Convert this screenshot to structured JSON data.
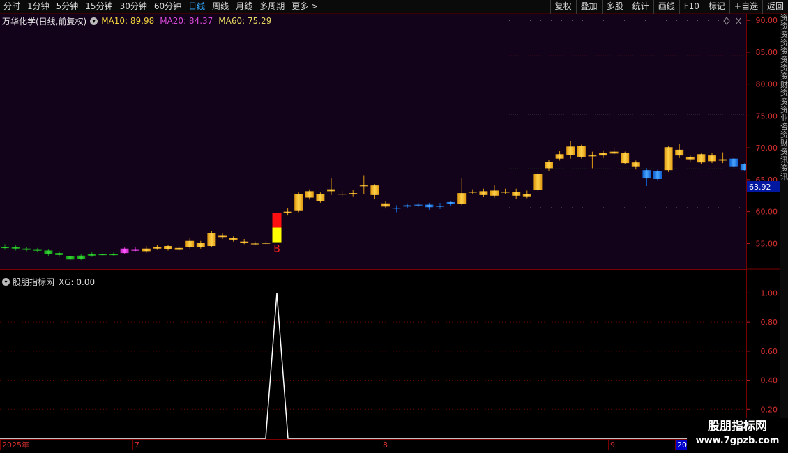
{
  "toolbar": {
    "periods": [
      "分时",
      "1分钟",
      "5分钟",
      "15分钟",
      "30分钟",
      "60分钟",
      "日线",
      "周线",
      "月线",
      "多周期",
      "更多"
    ],
    "active_index": 6,
    "right_items": [
      "复权",
      "叠加",
      "多股",
      "统计",
      "画线",
      "F10",
      "标记",
      "+自选",
      "返回"
    ]
  },
  "k_header": {
    "stock": "万华化学(日线,前复权)",
    "ma10": "MA10: 89.98",
    "ma20": "MA20: 84.37",
    "ma60": "MA60: 75.29"
  },
  "sub_header": {
    "title": "股朋指标网",
    "xg": "XG: 0.00"
  },
  "price_axis": [
    "90.00",
    "85.00",
    "80.00",
    "75.00",
    "70.00",
    "65.00",
    "60.00",
    "55.00"
  ],
  "current_price": "63.92",
  "sub_axis": [
    "1.00",
    "0.80",
    "0.60",
    "0.40",
    "0.20"
  ],
  "dates": [
    {
      "label": "2025年",
      "highlight": false
    },
    {
      "label": "7",
      "highlight": false
    },
    {
      "label": "8",
      "highlight": false
    },
    {
      "label": "9",
      "highlight": false
    },
    {
      "label": "20",
      "highlight": true
    }
  ],
  "signal_label": "B",
  "side_strip": "资资资资资资资资财资资资业咨资财资讯资讯",
  "watermark": {
    "line1": "股朋指标网",
    "line2": "www.7gpzb.com"
  },
  "chart_data": {
    "type": "candlestick",
    "y_range": [
      51,
      91
    ],
    "sub_y_range": [
      0,
      1.05
    ],
    "reference_lines": [
      {
        "value": 90.0,
        "color": "#888888"
      },
      {
        "value": 84.4,
        "color": "#d03030"
      },
      {
        "value": 75.3,
        "color": "#cccccc"
      },
      {
        "value": 66.7,
        "color": "#2e9e2e"
      },
      {
        "value": 60.6,
        "color": "#888888"
      }
    ],
    "candles": [
      [
        54.4,
        54.4,
        54.9,
        54.0,
        "green"
      ],
      [
        54.4,
        54.2,
        54.7,
        53.9,
        "green"
      ],
      [
        54.2,
        54.0,
        54.5,
        53.8,
        "green"
      ],
      [
        54.0,
        53.9,
        54.3,
        53.6,
        "green"
      ],
      [
        53.9,
        53.4,
        54.1,
        53.0,
        "green"
      ],
      [
        53.5,
        53.2,
        53.8,
        52.9,
        "green"
      ],
      [
        53.0,
        52.5,
        53.2,
        52.2,
        "green"
      ],
      [
        52.6,
        53.1,
        53.4,
        52.4,
        "green"
      ],
      [
        53.1,
        53.4,
        53.7,
        52.9,
        "green"
      ],
      [
        53.3,
        53.3,
        53.6,
        53.0,
        "green"
      ],
      [
        53.3,
        53.2,
        53.6,
        53.0,
        "green"
      ],
      [
        53.5,
        54.2,
        54.4,
        53.3,
        "magenta"
      ],
      [
        54.0,
        54.0,
        54.5,
        53.8,
        "magenta"
      ],
      [
        53.8,
        54.2,
        54.6,
        53.5,
        "gold"
      ],
      [
        54.2,
        54.5,
        54.8,
        54.0,
        "gold"
      ],
      [
        54.1,
        54.6,
        54.8,
        53.9,
        "gold"
      ],
      [
        54.0,
        54.3,
        54.6,
        53.8,
        "gold"
      ],
      [
        54.4,
        55.4,
        55.8,
        54.2,
        "gold"
      ],
      [
        54.4,
        55.1,
        55.4,
        54.2,
        "gold"
      ],
      [
        54.6,
        56.6,
        57.0,
        54.4,
        "gold"
      ],
      [
        56.0,
        56.3,
        56.6,
        55.7,
        "gold"
      ],
      [
        55.6,
        55.9,
        56.1,
        55.3,
        "gold"
      ],
      [
        55.1,
        55.3,
        55.7,
        54.9,
        "gold"
      ],
      [
        54.9,
        55.0,
        55.3,
        54.7,
        "gold"
      ],
      [
        55.0,
        55.1,
        55.4,
        54.8,
        "gold"
      ],
      [
        55.2,
        59.8,
        59.8,
        55.2,
        "redyellow"
      ],
      [
        59.8,
        60.0,
        60.5,
        59.4,
        "gold"
      ],
      [
        60.1,
        62.8,
        63.0,
        59.9,
        "gold"
      ],
      [
        62.2,
        63.2,
        63.5,
        61.9,
        "gold"
      ],
      [
        61.6,
        62.7,
        63.0,
        61.4,
        "gold"
      ],
      [
        63.2,
        63.5,
        65.2,
        62.6,
        "gold"
      ],
      [
        62.7,
        62.8,
        63.3,
        62.3,
        "gold"
      ],
      [
        62.8,
        62.9,
        63.4,
        62.4,
        "gold"
      ],
      [
        64.0,
        64.1,
        65.7,
        62.7,
        "gold"
      ],
      [
        62.6,
        64.1,
        64.3,
        62.0,
        "gold"
      ],
      [
        61.3,
        60.8,
        61.7,
        60.5,
        "gold"
      ],
      [
        60.6,
        60.6,
        61.0,
        59.9,
        "blue"
      ],
      [
        60.8,
        61.0,
        61.3,
        60.5,
        "blue"
      ],
      [
        61.0,
        61.1,
        61.4,
        60.7,
        "blue"
      ],
      [
        61.1,
        60.7,
        61.4,
        60.3,
        "blue"
      ],
      [
        60.9,
        60.9,
        61.4,
        60.4,
        "blue"
      ],
      [
        61.2,
        61.5,
        61.7,
        60.9,
        "blue"
      ],
      [
        61.2,
        62.9,
        65.3,
        61.0,
        "gold"
      ],
      [
        63.0,
        63.1,
        63.5,
        62.8,
        "gold"
      ],
      [
        62.6,
        63.2,
        63.6,
        62.3,
        "gold"
      ],
      [
        62.5,
        63.3,
        64.1,
        62.2,
        "gold"
      ],
      [
        63.0,
        63.1,
        63.6,
        62.7,
        "gold"
      ],
      [
        63.1,
        62.5,
        63.6,
        62.0,
        "gold"
      ],
      [
        62.4,
        62.8,
        63.3,
        62.1,
        "gold"
      ],
      [
        63.4,
        65.9,
        66.2,
        63.1,
        "gold"
      ],
      [
        66.8,
        67.8,
        68.1,
        66.3,
        "gold"
      ],
      [
        68.3,
        69.0,
        69.5,
        68.0,
        "gold"
      ],
      [
        70.2,
        68.9,
        71.0,
        68.3,
        "gold"
      ],
      [
        68.6,
        70.3,
        70.5,
        68.3,
        "gold"
      ],
      [
        68.8,
        68.7,
        69.4,
        66.8,
        "gold"
      ],
      [
        68.8,
        69.2,
        69.6,
        68.5,
        "gold"
      ],
      [
        69.1,
        69.4,
        70.1,
        68.8,
        "gold"
      ],
      [
        69.2,
        67.6,
        69.4,
        67.4,
        "gold"
      ],
      [
        67.7,
        67.1,
        68.0,
        66.6,
        "gold"
      ],
      [
        66.5,
        65.2,
        66.8,
        64.0,
        "blue"
      ],
      [
        66.3,
        65.1,
        66.6,
        64.9,
        "blue"
      ],
      [
        70.1,
        66.5,
        70.3,
        66.2,
        "gold"
      ],
      [
        69.7,
        68.8,
        70.6,
        68.5,
        "gold"
      ],
      [
        68.6,
        68.2,
        68.9,
        67.7,
        "gold"
      ],
      [
        69.0,
        67.7,
        69.1,
        67.4,
        "gold"
      ],
      [
        68.8,
        67.9,
        69.2,
        67.6,
        "gold"
      ],
      [
        68.2,
        68.0,
        69.3,
        67.6,
        "gold"
      ],
      [
        68.3,
        67.1,
        68.5,
        66.9,
        "blue"
      ],
      [
        67.4,
        66.5,
        67.6,
        66.3,
        "blue"
      ]
    ],
    "signal": {
      "index": 25,
      "label": "B"
    },
    "indicator_peak": {
      "index": 25,
      "value": 1.0
    }
  }
}
